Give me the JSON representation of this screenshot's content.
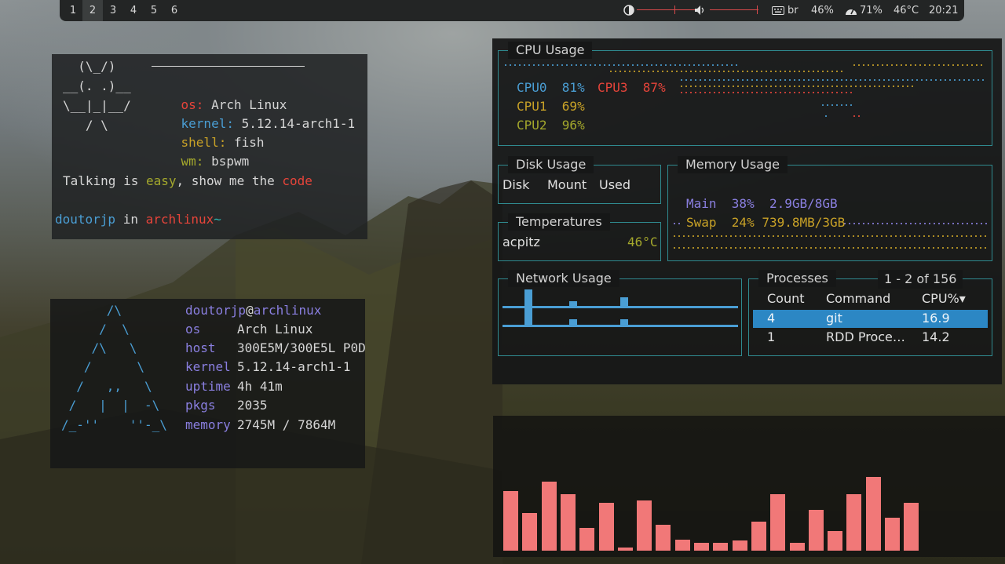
{
  "colors": {
    "accent_teal": "#2f8a8f",
    "blue": "#4a9ed4",
    "red": "#e6443a",
    "yellow": "#c9a227",
    "green": "#a4a82c",
    "purple": "#8a7fe0",
    "bar_red": "#f17878"
  },
  "topbar": {
    "workspaces": [
      "1",
      "2",
      "3",
      "4",
      "5",
      "6"
    ],
    "active_workspace": "2",
    "brightness_icon": "brightness-icon",
    "brightness_level": 0.72,
    "volume_icon": "volume-icon",
    "volume_level": 0.98,
    "keyboard_icon": "keyboard-icon",
    "keyboard_layout": "br",
    "brightness_pct": "46%",
    "cpu_icon": "gauge-icon",
    "cpu_pct": "71%",
    "temperature": "46°C",
    "clock": "20:21"
  },
  "fetch1": {
    "logo": [
      "  (\\_/)",
      "__(. .)__",
      "\\__|_|__/",
      "   / \\"
    ],
    "os_label": "os:",
    "os_value": "Arch Linux",
    "kernel_label": "kernel:",
    "kernel_value": "5.12.14-arch1-1",
    "shell_label": "shell:",
    "shell_value": "fish",
    "wm_label": "wm:",
    "wm_value": "bspwm",
    "quote_1": "Talking is ",
    "quote_2": "easy",
    "quote_3": ", show me the ",
    "quote_4": "code",
    "prompt_user": "doutorjp",
    "prompt_in": " in ",
    "prompt_host": "archlinux",
    "prompt_tilde": "~"
  },
  "fetch2": {
    "logo": [
      "      /\\",
      "     /  \\",
      "    /\\   \\",
      "   /      \\",
      "  /   ,,   \\",
      " /   |  |  -\\",
      "/_-''    ''-_\\"
    ],
    "user": "doutorjp",
    "at": "@",
    "host": "archlinux",
    "rows": [
      {
        "label": "os",
        "value": "Arch Linux"
      },
      {
        "label": "host",
        "value": "300E5M/300E5L P0D"
      },
      {
        "label": "kernel",
        "value": "5.12.14-arch1-1"
      },
      {
        "label": "uptime",
        "value": "4h 41m"
      },
      {
        "label": "pkgs",
        "value": "2035"
      },
      {
        "label": "memory",
        "value": "2745M / 7864M"
      }
    ]
  },
  "monitor": {
    "cpu": {
      "title": "CPU Usage",
      "cores": [
        {
          "name": "CPU0",
          "value": "81%"
        },
        {
          "name": "CPU3",
          "value": "87%"
        },
        {
          "name": "CPU1",
          "value": "69%"
        },
        {
          "name": "CPU2",
          "value": "96%"
        }
      ]
    },
    "disk": {
      "title": "Disk Usage",
      "headers": [
        "Disk",
        "Mount",
        "Used"
      ]
    },
    "temps": {
      "title": "Temperatures",
      "sensor": "acpitz",
      "value": "46°C"
    },
    "memory": {
      "title": "Memory Usage",
      "main_label": "Main",
      "main_pct": "38%",
      "main_amount": "2.9GB/8GB",
      "swap_label": "Swap",
      "swap_pct": "24%",
      "swap_amount": "739.8MB/3GB"
    },
    "network": {
      "title": "Network Usage"
    },
    "processes": {
      "title": "Processes",
      "range": "1 - 2 of 156",
      "headers": [
        "Count",
        "Command",
        "CPU%▾"
      ],
      "rows": [
        {
          "count": "4",
          "command": "git",
          "cpu": "16.9"
        },
        {
          "count": "1",
          "command": "RDD Proce…",
          "cpu": "14.2"
        }
      ]
    }
  },
  "visualizer": {
    "levels": [
      0.79,
      0.5,
      0.92,
      0.75,
      0.3,
      0.64,
      0.04,
      0.67,
      0.34,
      0.15,
      0.1,
      0.1,
      0.14,
      0.39,
      0.75,
      0.1,
      0.54,
      0.26,
      0.75,
      0.98,
      0.44,
      0.64
    ]
  }
}
